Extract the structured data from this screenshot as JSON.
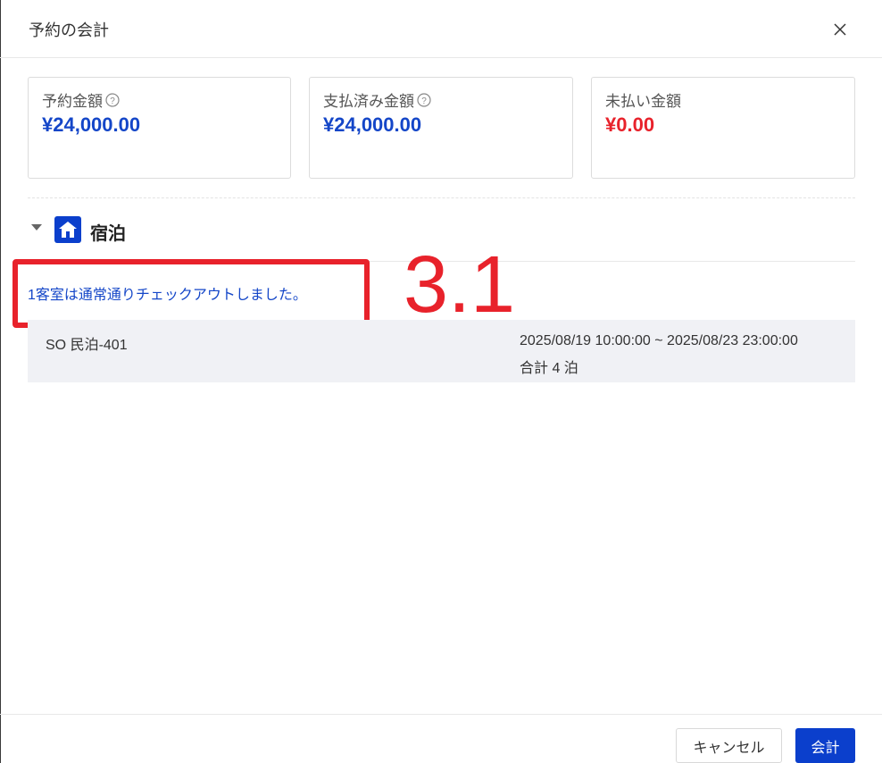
{
  "dialog": {
    "title": "予約の会計",
    "close_icon": "close-icon"
  },
  "summary": {
    "reserved": {
      "label": "予約金額",
      "amount": "¥24,000.00",
      "icon": "question-circle-icon"
    },
    "paid": {
      "label": "支払済み金額",
      "amount": "¥24,000.00",
      "icon": "question-circle-icon"
    },
    "unpaid": {
      "label": "未払い金額",
      "amount": "¥0.00"
    }
  },
  "colors": {
    "accent_blue": "#1446c8",
    "unpaid_red": "#e8222b",
    "primary_button": "#0b3fcc",
    "row_background": "#f0f1f5"
  },
  "lodging": {
    "title": "宿泊",
    "icon": "house-icon",
    "notice": "1客室は通常通りチェックアウトしました。",
    "rooms": [
      {
        "name": "SO 民泊-401",
        "dates": "2025/08/19 10:00:00 ~ 2025/08/23 23:00:00",
        "nights": "合計 4 泊"
      }
    ]
  },
  "annotation": {
    "label": "3.1"
  },
  "footer": {
    "cancel_label": "キャンセル",
    "pay_label": "会計"
  }
}
